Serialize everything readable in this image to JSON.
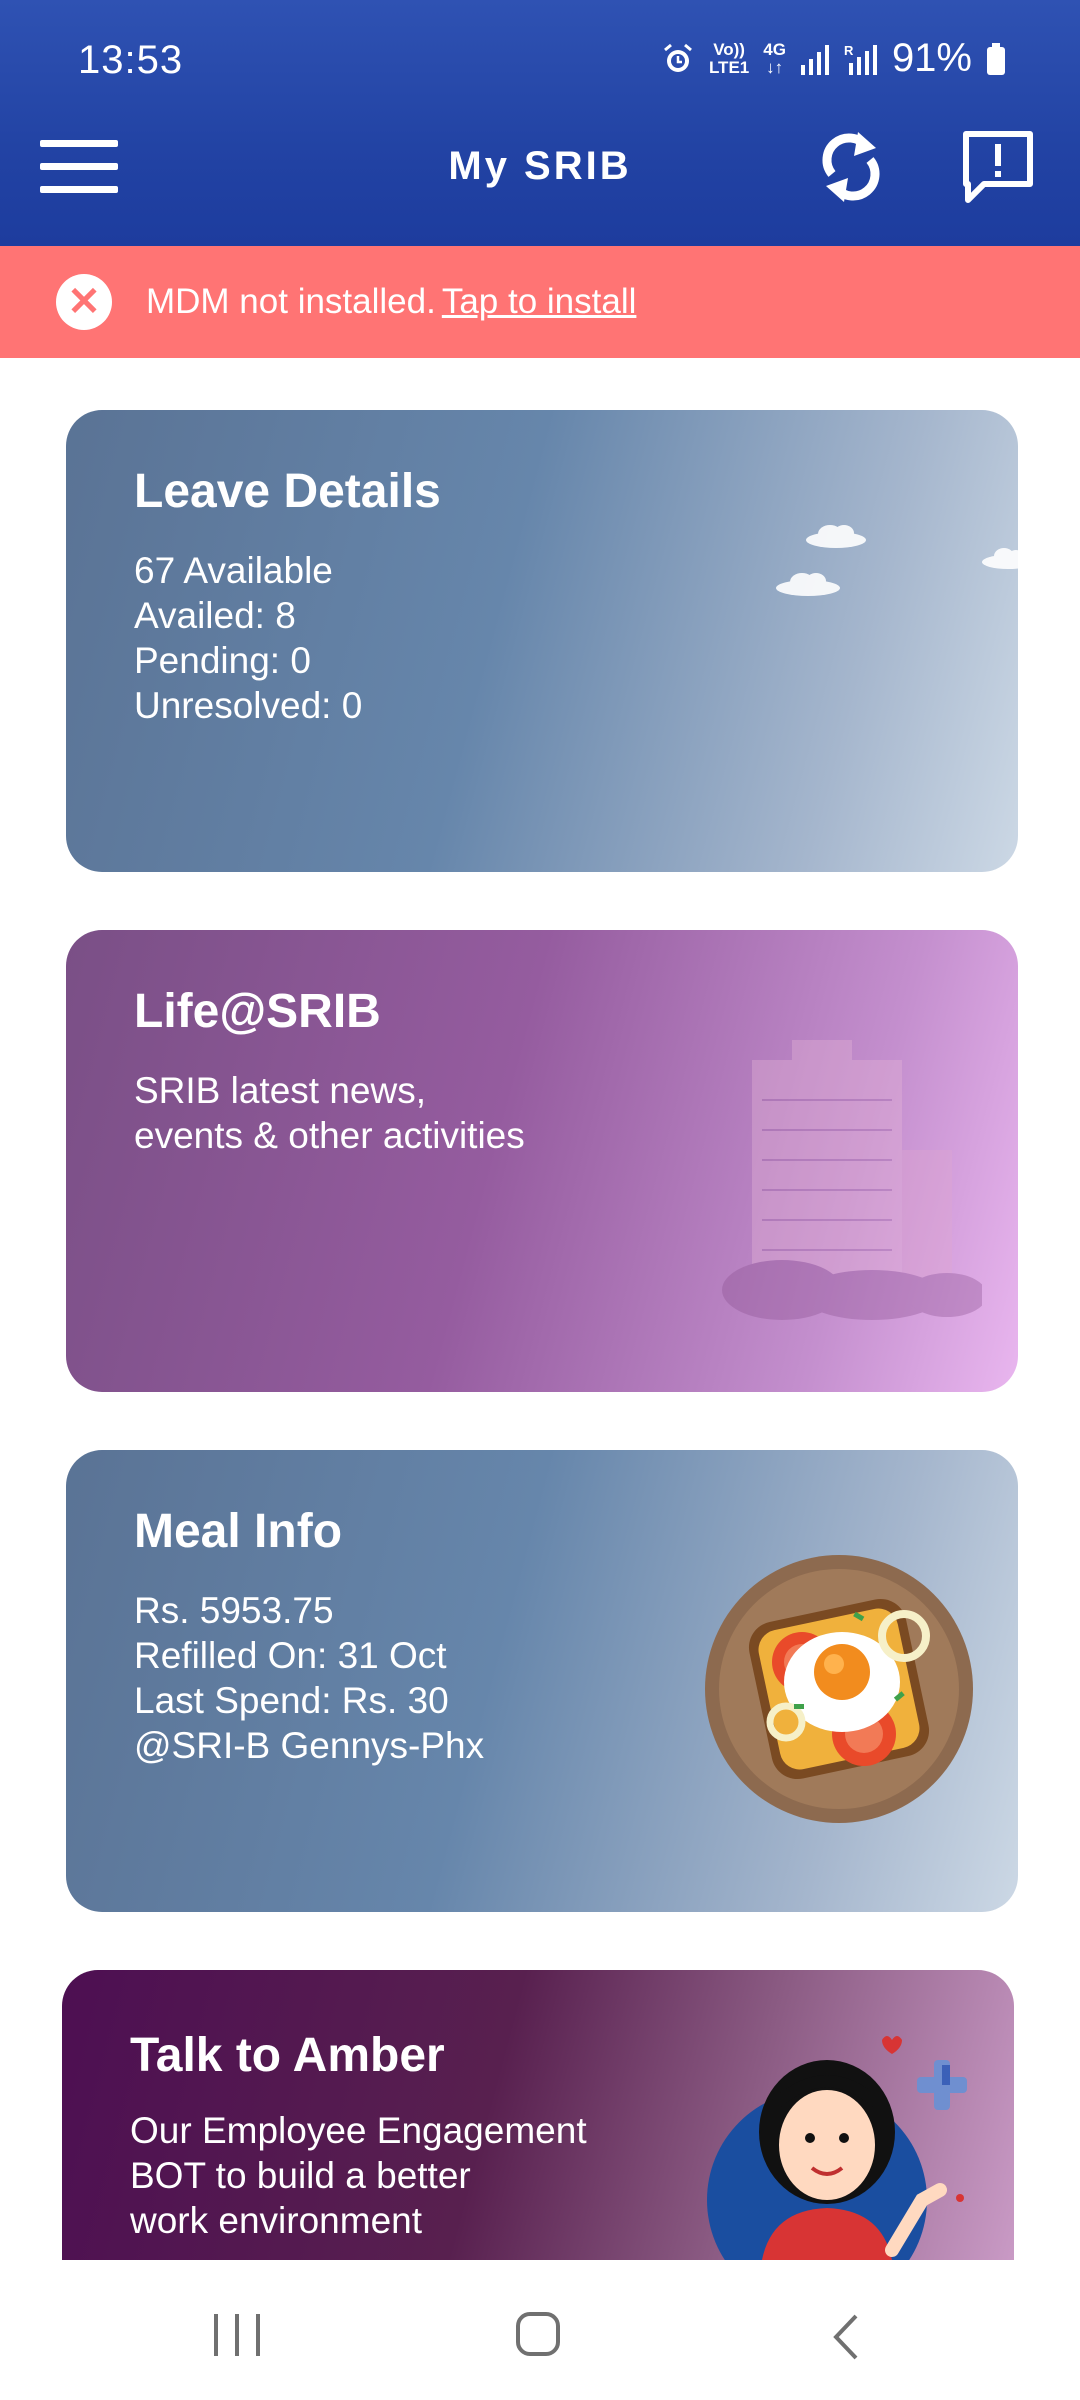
{
  "status_bar": {
    "time": "13:53",
    "network_top": "Vo))",
    "network_bottom": "LTE1",
    "net_type": "4G",
    "battery": "91%"
  },
  "app_bar": {
    "title": "My SRIB"
  },
  "banner": {
    "message": "MDM not installed.",
    "link": "Tap to install"
  },
  "cards": {
    "leave": {
      "title": "Leave Details",
      "lines": [
        "67 Available",
        "Availed: 8",
        "Pending: 0",
        "Unresolved: 0"
      ]
    },
    "life": {
      "title": "Life@SRIB",
      "lines": [
        "SRIB latest news,",
        "events & other activities"
      ]
    },
    "meal": {
      "title": "Meal Info",
      "lines": [
        "Rs. 5953.75",
        "Refilled On: 31 Oct",
        "Last Spend: Rs. 30",
        "@SRI-B Gennys-Phx"
      ]
    },
    "amber": {
      "title": "Talk to Amber",
      "lines": [
        "Our Employee Engagement",
        "BOT to build a better",
        "work environment"
      ]
    }
  },
  "colors": {
    "app_bar": "#2243a4",
    "banner": "#ff7474",
    "leave_card": "#6686ab",
    "life_card": "#955c9f",
    "amber_card": "#4d0f52"
  }
}
